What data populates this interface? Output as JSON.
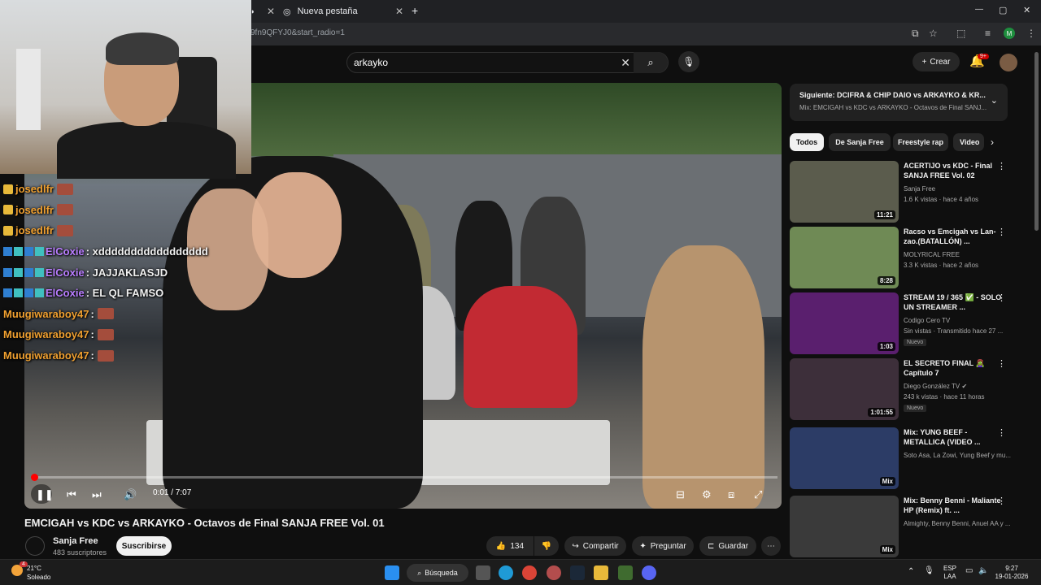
{
  "browser": {
    "tabs": [
      {
        "label": "",
        "close": "✕"
      },
      {
        "label": "Nueva pestaña",
        "close": "✕"
      }
    ],
    "new_tab": "+",
    "url": "9fn9QFYJ0&start_radio=1",
    "profile_initial": "M",
    "window_controls": {
      "minimize": "—",
      "maximize": "▢",
      "close": "✕"
    }
  },
  "youtube": {
    "search_query": "arkayko",
    "create_label": "Crear",
    "notifications_badge": "9+",
    "video": {
      "title": "EMCIGAH vs KDC vs ARKAYKO - Octavos de Final SANJA FREE Vol. 01",
      "time": "0:01 / 7:07",
      "progress": 0.002,
      "channel": "Sanja Free",
      "subscribers": "483 suscriptores",
      "subscribe_label": "Suscribirse",
      "likes": "134",
      "share_label": "Compartir",
      "ask_label": "Preguntar",
      "save_label": "Guardar",
      "more": "⋯"
    },
    "next_up": {
      "title": "Siguiente: DCIFRA & CHIP DAIO vs ARKAYKO & KR...",
      "subtitle": "Mix: EMCIGAH vs KDC vs ARKAYKO - Octavos de Final SANJ..."
    },
    "chips": [
      "Todos",
      "De Sanja Free",
      "Freestyle rap",
      "Video"
    ],
    "recommendations": [
      {
        "title": "ACERTIJO vs KDC - Final SANJA FREE Vol. 02",
        "channel": "Sanja Free",
        "meta": "1.6 K vistas · hace 4 años",
        "duration": "11:21",
        "badge": "",
        "color": "#5b5c4d"
      },
      {
        "title": "Racso vs Emcigah vs Lan-zao.(BATALLÓN) ...",
        "channel": "MOLYRICAL FREE",
        "meta": "3.3 K vistas · hace 2 años",
        "duration": "8:28",
        "badge": "",
        "color": "#6f8a55"
      },
      {
        "title": "STREAM 19 / 365 ✅ - SOLO UN STREAMER ...",
        "channel": "Codigo Cero TV",
        "meta": "Sin vistas · Transmitido hace 27 ...",
        "duration": "1:03",
        "badge": "Nuevo",
        "color": "#5a1f6e"
      },
      {
        "title": "EL SECRETO FINAL 🧟‍♀️ Capítulo 7",
        "channel": "Diego González TV ✔",
        "meta": "243 k vistas · hace 11 horas",
        "duration": "1:01:55",
        "badge": "Nuevo",
        "color": "#3d2f3a"
      },
      {
        "title": "Mix: YUNG BEEF - METALLICA (VIDEO ...",
        "channel": "Soto Asa, La Zowi, Yung Beef y mu...",
        "meta": "",
        "duration": "Mix",
        "badge": "",
        "color": "#2c3c66"
      },
      {
        "title": "Mix: Benny Benni - Maliante HP (Remix) ft. ...",
        "channel": "Almighty, Benny Benni, Anuel AA y ...",
        "meta": "",
        "duration": "Mix",
        "badge": "",
        "color": "#3a3a3a"
      }
    ]
  },
  "chat": [
    {
      "user": "josedlfr",
      "text": "",
      "color": "#f0a030",
      "badges": "crown",
      "emote": true
    },
    {
      "user": "josedlfr",
      "text": "",
      "color": "#f0a030",
      "badges": "crown",
      "emote": true
    },
    {
      "user": "josedlfr",
      "text": "",
      "color": "#f0a030",
      "badges": "crown",
      "emote": true
    },
    {
      "user": "ElCoxie",
      "text": ": xddddddddddddddddd",
      "color": "#b97dff",
      "badges": "sub",
      "emote": false
    },
    {
      "user": "ElCoxie",
      "text": ": JAJJAKLASJD",
      "color": "#b97dff",
      "badges": "sub",
      "emote": false
    },
    {
      "user": "ElCoxie",
      "text": ": EL QL FAMSO",
      "color": "#b97dff",
      "badges": "sub",
      "emote": false
    },
    {
      "user": "Muugiwaraboy47",
      "text": ":",
      "color": "#f0a030",
      "badges": "none",
      "emote": true
    },
    {
      "user": "Muugiwaraboy47",
      "text": ":",
      "color": "#f0a030",
      "badges": "none",
      "emote": true
    },
    {
      "user": "Muugiwaraboy47",
      "text": ":",
      "color": "#f0a030",
      "badges": "none",
      "emote": true
    }
  ],
  "taskbar": {
    "weather_temp": "21°C",
    "weather_desc": "Soleado",
    "weather_badge": "4",
    "search_label": "Búsqueda",
    "lang_top": "ESP",
    "lang_bottom": "LAA",
    "time": "9:27",
    "date": "19-01-2026"
  }
}
